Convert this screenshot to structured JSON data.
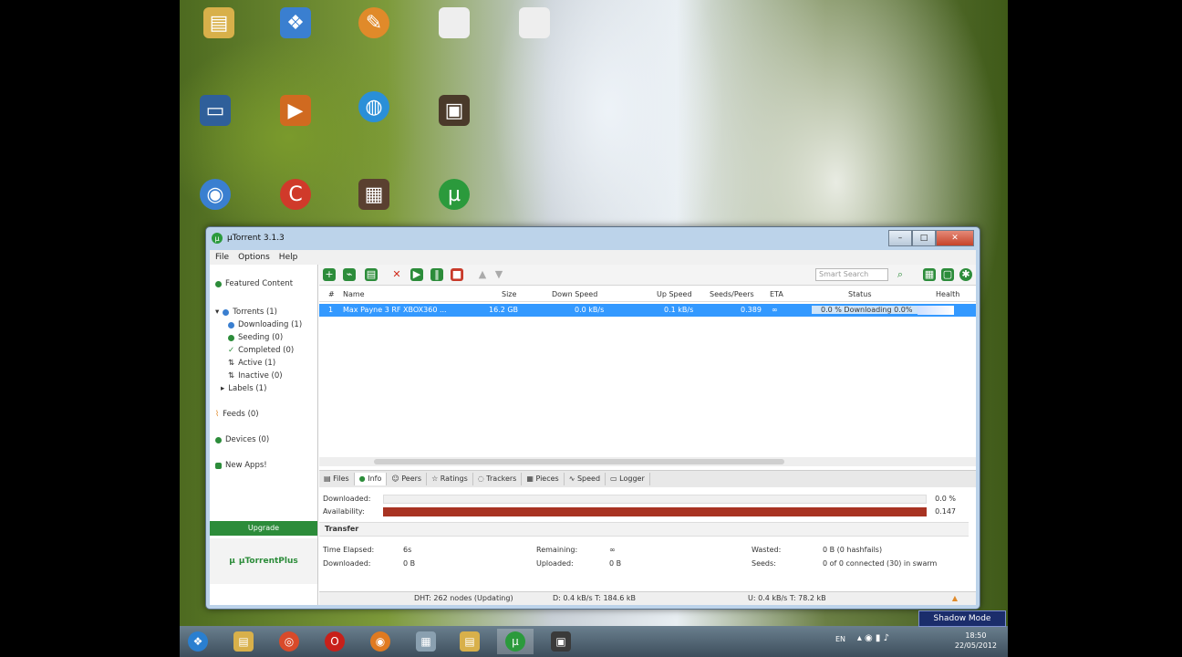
{
  "window": {
    "title": "µTorrent 3.1.3",
    "menu": [
      "File",
      "Options",
      "Help"
    ]
  },
  "sidebar": {
    "featured": "Featured Content",
    "torrents": "Torrents (1)",
    "downloading": "Downloading (1)",
    "seeding": "Seeding (0)",
    "completed": "Completed (0)",
    "active": "Active (1)",
    "inactive": "Inactive (0)",
    "labels": "Labels (1)",
    "feeds": "Feeds (0)",
    "devices": "Devices (0)",
    "new_apps": "New Apps!",
    "upgrade": "Upgrade",
    "plus_logo": "µTorrentPlus"
  },
  "toolbar": {
    "search_placeholder": "Smart Search"
  },
  "list": {
    "columns": [
      "#",
      "Name",
      "Size",
      "Down Speed",
      "Up Speed",
      "Seeds/Peers",
      "ETA",
      "Status",
      "Health"
    ],
    "row": {
      "num": "1",
      "name": "Max Payne 3 RF XBOX360 ...",
      "size": "16.2 GB",
      "down_speed": "0.0 kB/s",
      "up_speed": "0.1 kB/s",
      "seeds_peers": "0.389",
      "eta": "∞",
      "status": "0.0 % Downloading 0.0%",
      "health": ""
    }
  },
  "tabs": [
    "Files",
    "Info",
    "Peers",
    "Ratings",
    "Trackers",
    "Pieces",
    "Speed",
    "Logger"
  ],
  "info": {
    "downloaded_label": "Downloaded:",
    "availability_label": "Availability:",
    "downloaded_pct": "0.0 %",
    "availability_val": "0.147",
    "transfer": "Transfer",
    "time_elapsed_label": "Time Elapsed:",
    "time_elapsed": "6s",
    "remaining_label": "Remaining:",
    "remaining": "∞",
    "wasted_label": "Wasted:",
    "wasted": "0 B (0 hashfails)",
    "downloaded2_label": "Downloaded:",
    "downloaded2": "0 B",
    "uploaded_label": "Uploaded:",
    "uploaded": "0 B",
    "seeds_label": "Seeds:",
    "seeds": "0 of 0 connected (30) in swarm"
  },
  "status": {
    "dht": "DHT: 262 nodes (Updating)",
    "down": "D: 0.4 kB/s T: 184.6 kB",
    "up": "U: 0.4 kB/s T: 78.2 kB"
  },
  "taskbar": {
    "time": "18:50",
    "date": "22/05/2012",
    "tray_lang": "EN"
  },
  "overlay": {
    "shadow_mode": "Shadow Mode"
  },
  "colors": {
    "selected_row": "#3399ff",
    "availability_bar": "#a83322",
    "utorrent_green": "#2c8c3a"
  }
}
